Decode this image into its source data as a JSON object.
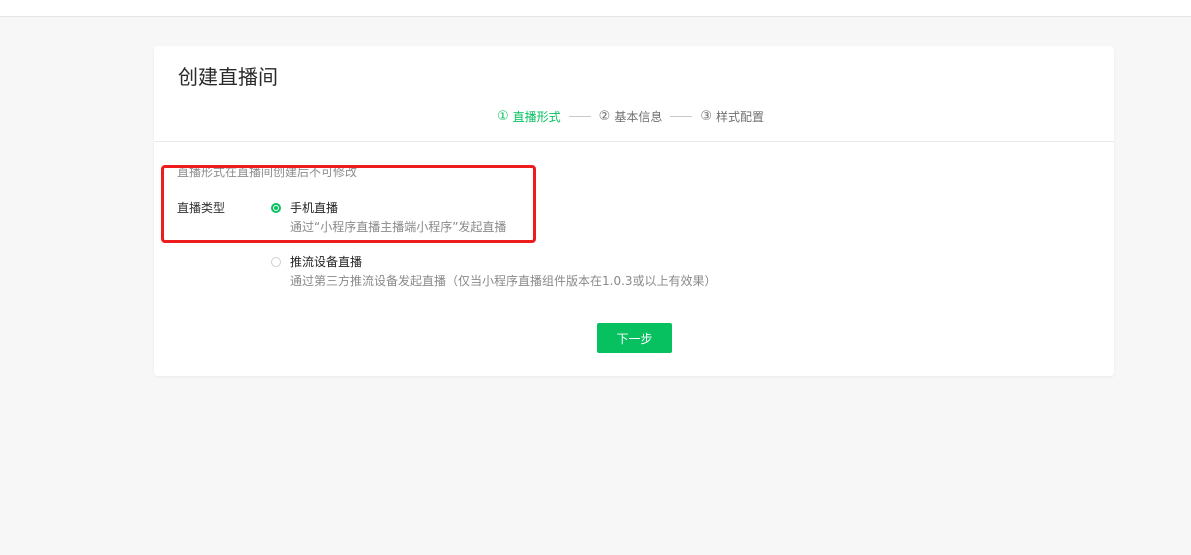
{
  "page": {
    "title": "创建直播间"
  },
  "steps": [
    {
      "num": "①",
      "label": "直播形式",
      "active": true
    },
    {
      "num": "②",
      "label": "基本信息",
      "active": false
    },
    {
      "num": "③",
      "label": "样式配置",
      "active": false
    }
  ],
  "form": {
    "tip": "直播形式在直播间创建后不可修改",
    "type_label": "直播类型",
    "options": [
      {
        "title": "手机直播",
        "desc": "通过“小程序直播主播端小程序”发起直播",
        "selected": true
      },
      {
        "title": "推流设备直播",
        "desc": "通过第三方推流设备发起直播（仅当小程序直播组件版本在1.0.3或以上有效果）",
        "selected": false
      }
    ]
  },
  "actions": {
    "next_label": "下一步"
  },
  "colors": {
    "accent": "#07c160",
    "annotation": "#ee1c1c",
    "background": "#f7f7f8"
  }
}
